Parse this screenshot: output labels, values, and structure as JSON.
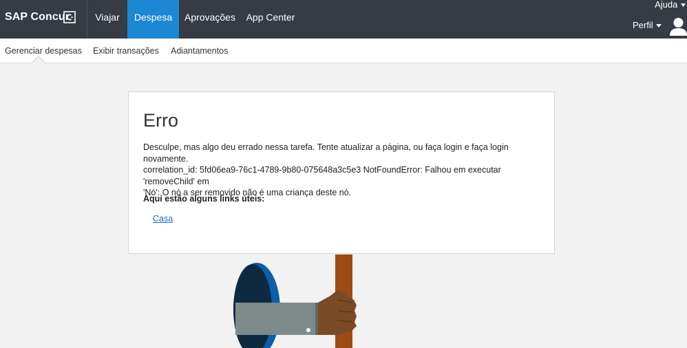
{
  "brand": {
    "name": "SAP Concur",
    "logo_icon": "concur-c-logo-icon"
  },
  "nav": {
    "items": [
      {
        "label": "Viajar"
      },
      {
        "label": "Despesa",
        "active": true
      },
      {
        "label": "Aprovações"
      },
      {
        "label": "App Center"
      }
    ],
    "help_label": "Ajuda",
    "profile_label": "Perfil"
  },
  "subnav": {
    "items": [
      {
        "label": "Gerenciar despesas",
        "active": true
      },
      {
        "label": "Exibir transações"
      },
      {
        "label": "Adiantamentos"
      }
    ]
  },
  "error": {
    "title": "Erro",
    "message_line1": "Desculpe, mas algo deu errado nessa tarefa. Tente atualizar a página, ou faça login e faça login novamente.",
    "message_line2": "correlation_id: 5fd06ea9-76c1-4789-9b80-075648a3c5e3 NotFoundError: Falhou em executar 'removeChild' em",
    "message_line3": "'Nó': O nó a ser removido não é uma criança deste nó.",
    "links_title": "Aqui estão alguns links úteis:",
    "links": [
      {
        "label": "Casa"
      }
    ]
  },
  "colors": {
    "topbar": "#353c44",
    "active_nav": "#1c87d3",
    "link": "#1a6fb5"
  }
}
